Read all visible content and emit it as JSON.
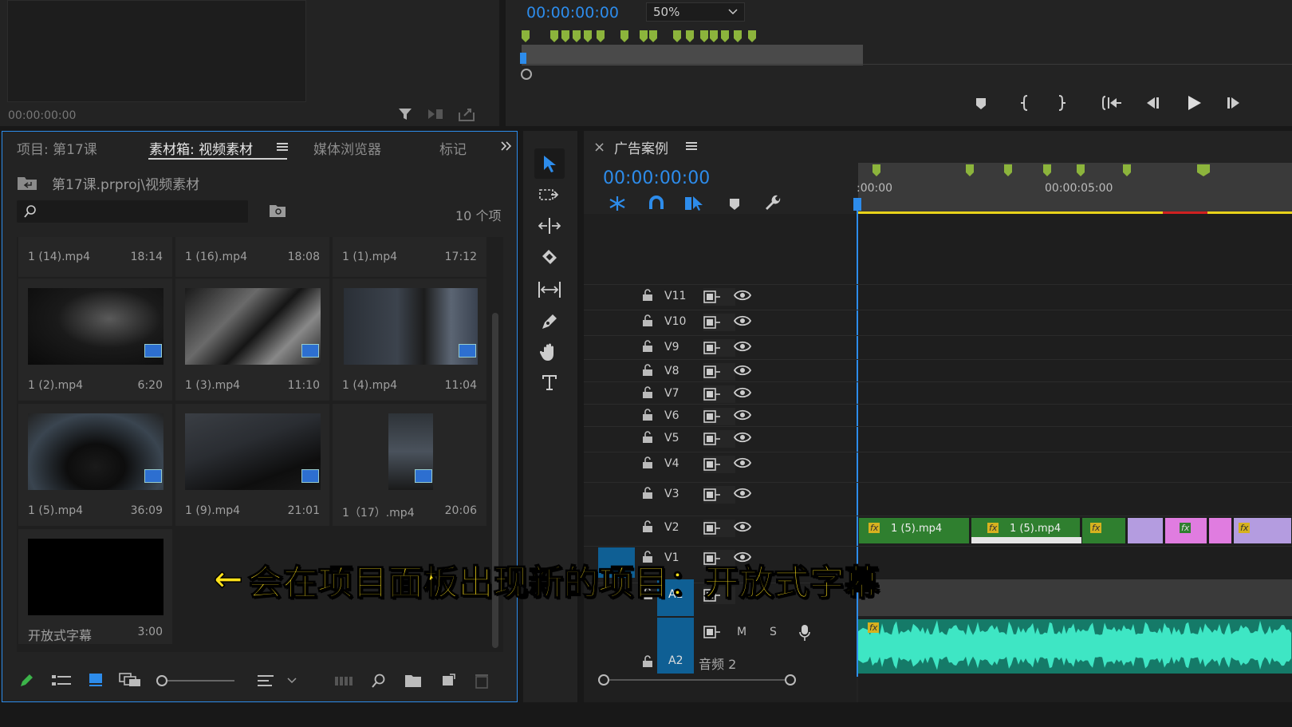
{
  "source_monitor": {
    "timecode": "00:00:00:00"
  },
  "program_monitor": {
    "timecode": "00:00:00:00",
    "zoom": "50%"
  },
  "project_panel": {
    "tabs": [
      "项目: 第17课",
      "素材箱: 视频素材",
      "媒体浏览器",
      "标记"
    ],
    "active_tab_index": 1,
    "path": "第17课.prproj\\视频素材",
    "search_placeholder": "",
    "item_count": "10 个项",
    "row0": [
      {
        "name": "1 (14).mp4",
        "duration": "18:14"
      },
      {
        "name": "1 (16).mp4",
        "duration": "18:08"
      },
      {
        "name": "1 (1).mp4",
        "duration": "17:12"
      }
    ],
    "items": [
      {
        "name": "1 (2).mp4",
        "duration": "6:20"
      },
      {
        "name": "1 (3).mp4",
        "duration": "11:10"
      },
      {
        "name": "1 (4).mp4",
        "duration": "11:04"
      },
      {
        "name": "1 (5).mp4",
        "duration": "36:09"
      },
      {
        "name": "1 (9).mp4",
        "duration": "21:01"
      },
      {
        "name": "1（17）.mp4",
        "duration": "20:06"
      },
      {
        "name": "开放式字幕",
        "duration": "3:00"
      }
    ]
  },
  "timeline": {
    "close": "×",
    "title": "广告案例",
    "timecode": "00:00:00:00",
    "ruler": [
      ":00:00",
      "00:00:05:00"
    ],
    "tracks": [
      "V11",
      "V10",
      "V9",
      "V8",
      "V7",
      "V6",
      "V5",
      "V4",
      "V3",
      "V2",
      "V1",
      "A1",
      "A2"
    ],
    "audio_track_name": "音频 2",
    "m_label": "M",
    "s_label": "S",
    "clips": [
      {
        "label": "1 (5).mp4",
        "color": "#2f7f2f"
      },
      {
        "label": "1 (5).mp4",
        "color": "#2f7f2f"
      }
    ]
  },
  "annotation": {
    "arrow": "←",
    "text": "会在项目面板出现新的项目：开放式字幕"
  },
  "colors": {
    "accent": "#2d8ceb",
    "panel_border": "#2d8ceb",
    "marker": "#8cb43c",
    "audio": "#3ee6c4",
    "annotation": "#ffe21a"
  }
}
